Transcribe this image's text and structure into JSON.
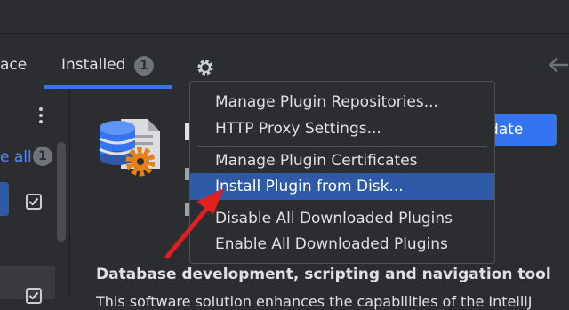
{
  "tabs": [
    {
      "label": "ace"
    },
    {
      "label": "Installed",
      "badge": "1"
    }
  ],
  "sidebar": {
    "update_all": "e all",
    "update_badge": "1"
  },
  "plugin": {
    "update_button": "date",
    "description_title": "Database development, scripting and navigation tool",
    "description_body": "This software solution enhances the capabilities of the IntelliJ"
  },
  "menu": {
    "items": [
      {
        "label": "Manage Plugin Repositories..."
      },
      {
        "label": "HTTP Proxy Settings..."
      },
      {
        "label": "Manage Plugin Certificates"
      },
      {
        "label": "Install Plugin from Disk...",
        "selected": true
      },
      {
        "label": "Disable All Downloaded Plugins"
      },
      {
        "label": "Enable All Downloaded Plugins"
      }
    ]
  },
  "icons": [
    "gear-icon",
    "back-arrow-icon",
    "more-vertical-icon",
    "database-plugin-icon",
    "checkbox-checked-icon",
    "red-arrow-annotation"
  ],
  "colors": {
    "accent": "#3574f0",
    "selection": "#2e5aa8",
    "annotation": "#e0201f"
  }
}
